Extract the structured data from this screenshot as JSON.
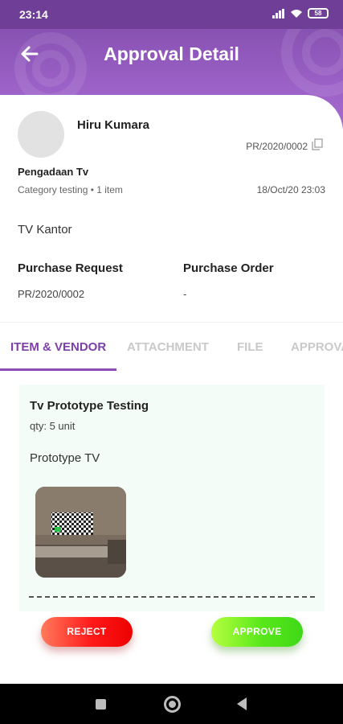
{
  "status_bar": {
    "time": "23:14",
    "battery": "58"
  },
  "header": {
    "title": "Approval Detail"
  },
  "request": {
    "requester_name": "Hiru Kumara",
    "document_number": "PR/2020/0002",
    "title": "Pengadaan Tv",
    "category_line": "Category testing • 1 item",
    "date": "18/Oct/20 23:03",
    "description": "TV Kantor",
    "purchase_request_label": "Purchase Request",
    "purchase_request_value": "PR/2020/0002",
    "purchase_order_label": "Purchase Order",
    "purchase_order_value": "-"
  },
  "tabs": [
    {
      "label": "ITEM & VENDOR",
      "active": true
    },
    {
      "label": "ATTACHMENT",
      "active": false
    },
    {
      "label": "FILE",
      "active": false
    },
    {
      "label": "APPROVAL",
      "active": false
    }
  ],
  "item": {
    "name": "Tv Prototype Testing",
    "qty": "qty: 5 unit",
    "description": "Prototype TV"
  },
  "actions": {
    "reject_label": "REJECT",
    "approve_label": "APPROVE"
  },
  "colors": {
    "header": "#9d62c8",
    "accent": "#7d3fa8",
    "reject": "#ff1a1a",
    "approve": "#58e81a",
    "panel": "#f3fcf6"
  }
}
